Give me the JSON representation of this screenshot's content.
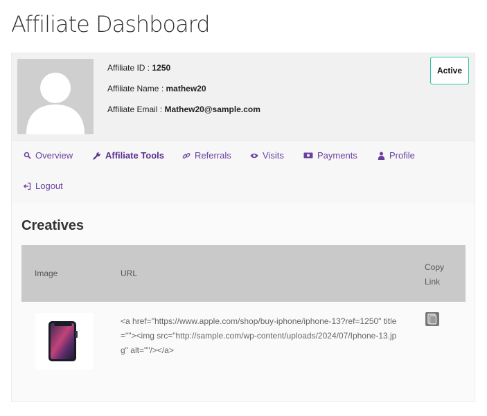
{
  "page": {
    "title": "Affiliate Dashboard"
  },
  "profile": {
    "id_label": "Affiliate ID : ",
    "id_value": "1250",
    "name_label": "Affiliate Name : ",
    "name_value": "mathew20",
    "email_label": "Affiliate Email : ",
    "email_value": "Mathew20@sample.com",
    "status": "Active"
  },
  "nav": {
    "items": [
      {
        "label": "Overview",
        "icon": "search-icon"
      },
      {
        "label": "Affiliate Tools",
        "icon": "wrench-icon",
        "active": true
      },
      {
        "label": "Referrals",
        "icon": "link-icon"
      },
      {
        "label": "Visits",
        "icon": "eye-icon"
      },
      {
        "label": "Payments",
        "icon": "money-icon"
      },
      {
        "label": "Profile",
        "icon": "user-icon"
      },
      {
        "label": "Logout",
        "icon": "logout-icon"
      }
    ]
  },
  "creatives": {
    "title": "Creatives",
    "columns": {
      "image": "Image",
      "url": "URL",
      "copy": "Copy Link"
    },
    "rows": [
      {
        "image_icon": "iphone-13-thumbnail",
        "url": "<a href=\"https://www.apple.com/shop/buy-iphone/iphone-13?ref=1250\" title=\"\"><img src=\"http://sample.com/wp-content/uploads/2024/07/Iphone-13.jpg\" alt=\"\"/></a>",
        "copy_icon": "copy-icon"
      }
    ]
  },
  "colors": {
    "accent": "#6b3fa0",
    "status_border": "#27c2a6",
    "table_header": "#c9c9c9"
  }
}
